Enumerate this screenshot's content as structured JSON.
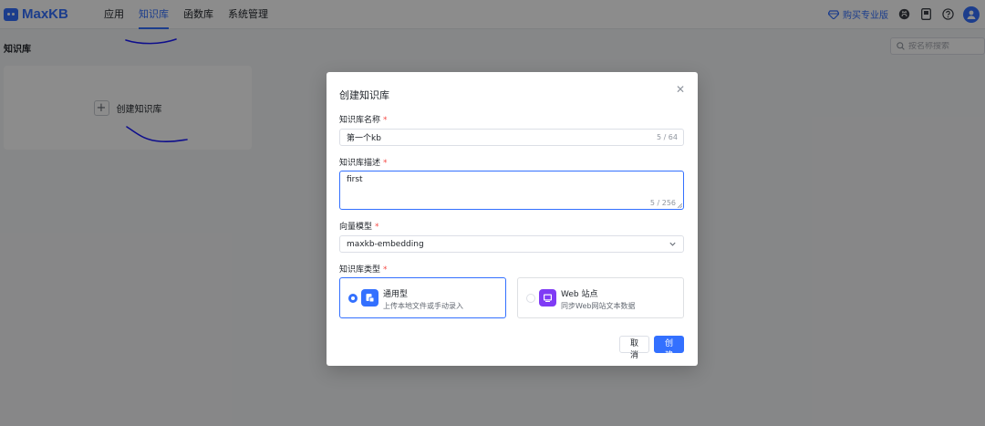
{
  "header": {
    "logo_text": "MaxKB",
    "nav": [
      {
        "label": "应用",
        "active": false
      },
      {
        "label": "知识库",
        "active": true
      },
      {
        "label": "函数库",
        "active": false
      },
      {
        "label": "系统管理",
        "active": false
      }
    ],
    "pro_label": "购买专业版",
    "icons": [
      "diamond-icon",
      "github-icon",
      "document-icon",
      "help-icon",
      "user-avatar-icon"
    ]
  },
  "page": {
    "title": "知识库",
    "search_placeholder": "按名称搜索",
    "create_card_label": "创建知识库"
  },
  "dialog": {
    "title": "创建知识库",
    "name": {
      "label": "知识库名称",
      "required_mark": "*",
      "value": "第一个kb",
      "count": "5 / 64"
    },
    "description": {
      "label": "知识库描述",
      "required_mark": "*",
      "value": "first",
      "count": "5 / 256"
    },
    "model": {
      "label": "向量模型",
      "required_mark": "*",
      "value": "maxkb-embedding"
    },
    "type": {
      "label": "知识库类型",
      "required_mark": "*",
      "options": [
        {
          "name": "通用型",
          "desc": "上传本地文件或手动录入",
          "selected": true,
          "icon": "document-upload-icon"
        },
        {
          "name": "Web 站点",
          "desc": "同步Web网站文本数据",
          "selected": false,
          "icon": "web-site-icon"
        }
      ]
    },
    "cancel_label": "取消",
    "create_label": "创建"
  },
  "colors": {
    "accent": "#3370ff",
    "web_icon": "#7f3bf5",
    "required": "#f54a45",
    "annotation": "#1a1aff"
  }
}
